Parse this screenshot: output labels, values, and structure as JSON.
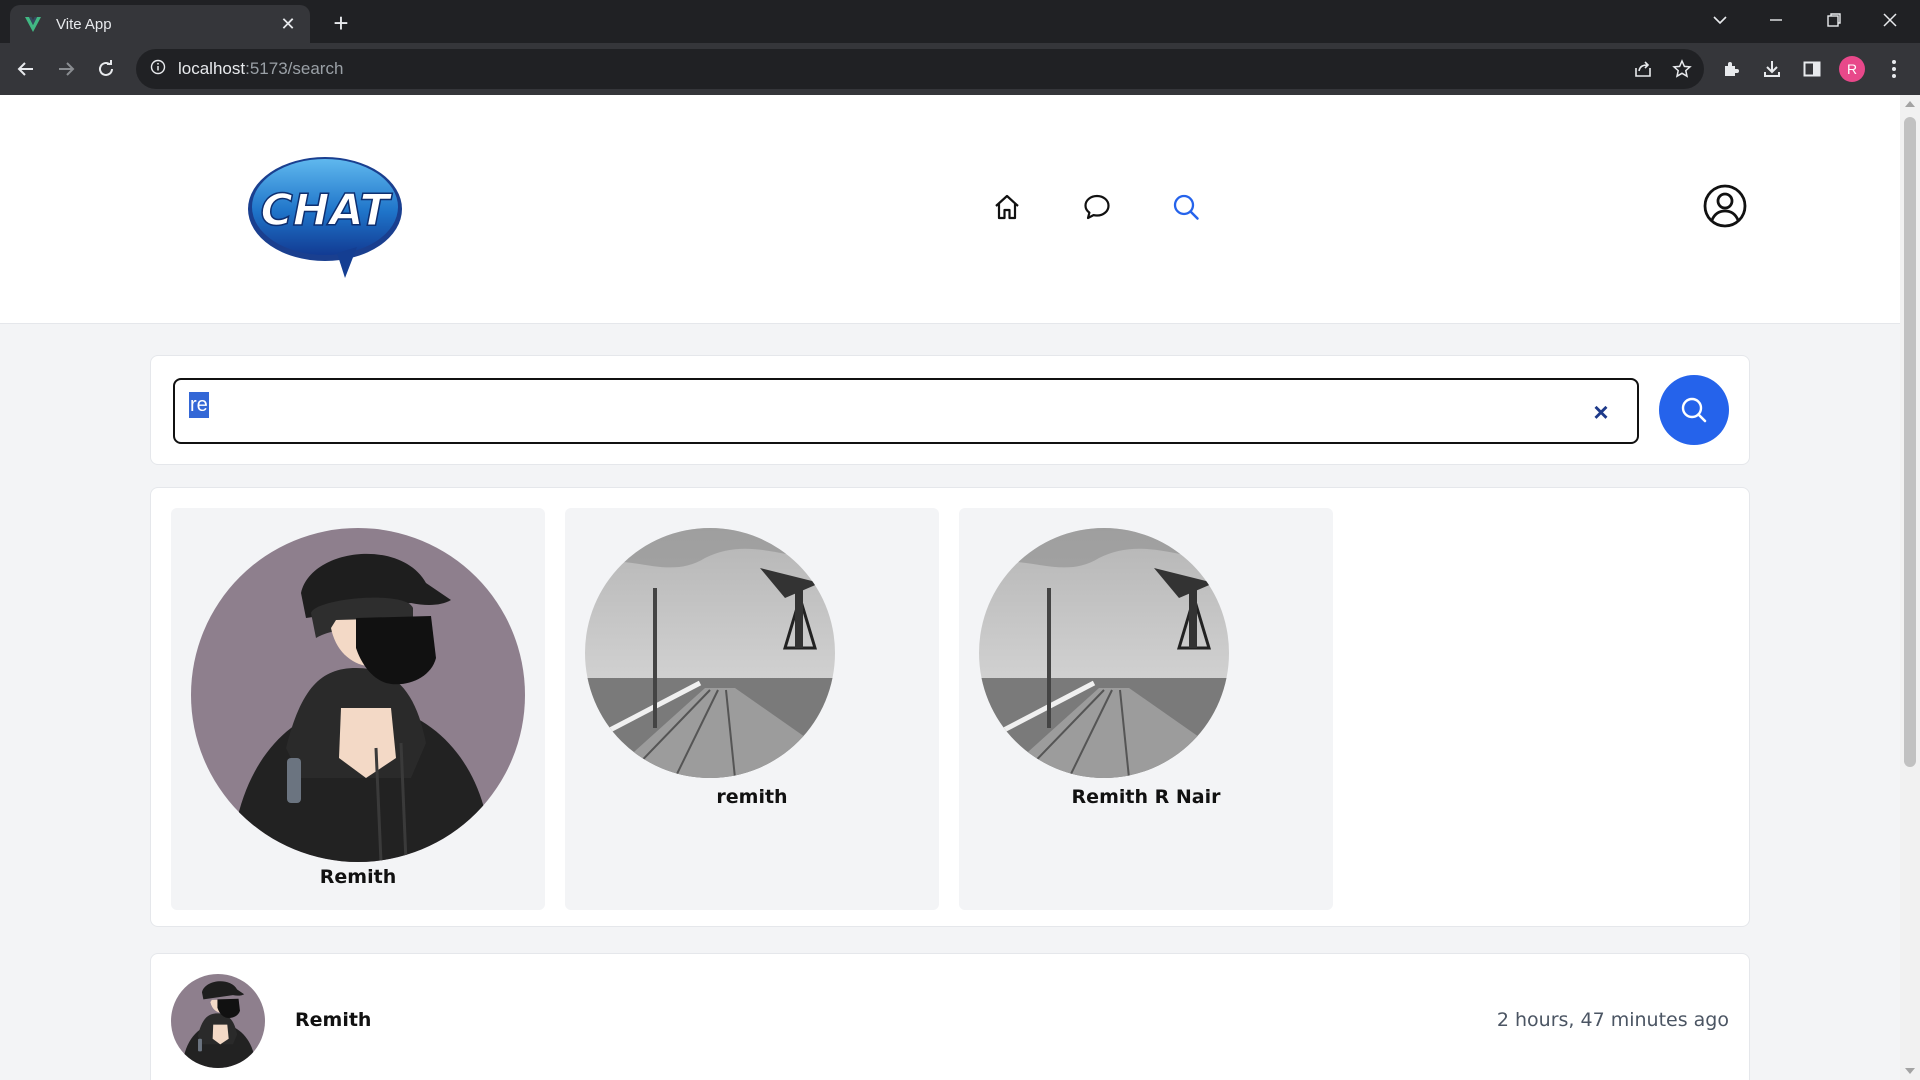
{
  "browser": {
    "tab_title": "Vite App",
    "tab_close": "✕",
    "new_tab": "+",
    "url_host": "localhost",
    "url_path": ":5173/search",
    "profile_initial": "R"
  },
  "colors": {
    "accent": "#2563eb",
    "active_nav": "#2563eb",
    "profile_badge": "#e8488a",
    "selection": "#3367d6"
  },
  "header": {
    "logo_text": "CHAT",
    "nav": [
      {
        "name": "home",
        "icon": "home-icon",
        "active": false
      },
      {
        "name": "chats",
        "icon": "chat-bubble-icon",
        "active": false
      },
      {
        "name": "search",
        "icon": "search-icon",
        "active": true
      }
    ],
    "account_icon": "user-circle-icon"
  },
  "search": {
    "value": "re",
    "clear_label": "×",
    "button_icon": "search-icon"
  },
  "results": [
    {
      "name": "Remith",
      "avatar": "masked-person-avatar"
    },
    {
      "name": "remith",
      "avatar": "pier-photo-avatar"
    },
    {
      "name": "Remith R Nair",
      "avatar": "pier-photo-avatar"
    }
  ],
  "recent": {
    "name": "Remith",
    "time": "2 hours, 47 minutes ago",
    "avatar": "masked-person-avatar"
  }
}
